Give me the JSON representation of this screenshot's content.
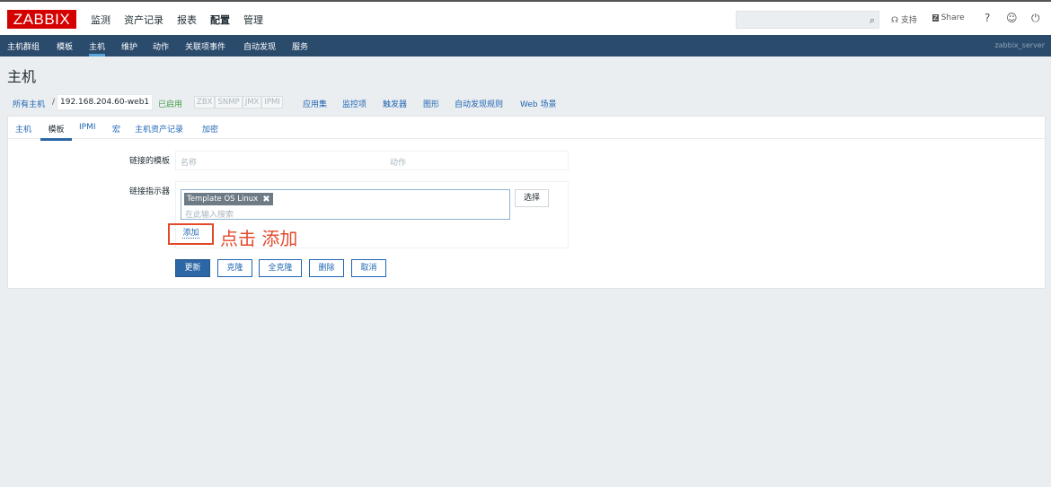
{
  "brand": "ZABBIX",
  "main_menu": [
    "监测",
    "资产记录",
    "报表",
    "配置",
    "管理"
  ],
  "main_menu_active": "配置",
  "header": {
    "support_label": "支持",
    "share_label": "Share",
    "help_label": "?"
  },
  "sub_menu": [
    "主机群组",
    "模板",
    "主机",
    "维护",
    "动作",
    "关联项事件",
    "自动发现",
    "服务"
  ],
  "sub_menu_active": "主机",
  "server_name": "zabbix_server",
  "page_title": "主机",
  "breadcrumb": {
    "all_hosts": "所有主机",
    "separator": "/",
    "host": "192.168.204.60-web1",
    "status": "已启用",
    "availability": [
      "ZBX",
      "SNMP",
      "JMX",
      "IPMI"
    ],
    "links": [
      "应用集",
      "监控项",
      "触发器",
      "图形",
      "自动发现规则",
      "Web 场景"
    ]
  },
  "tabs": [
    "主机",
    "模板",
    "IPMI",
    "宏",
    "主机资产记录",
    "加密"
  ],
  "active_tab": "模板",
  "form": {
    "linked_templates_label": "链接的模板",
    "col_name": "名称",
    "col_action": "动作",
    "link_indicator_label": "链接指示器",
    "selected_template": "Template OS Linux",
    "chip_remove": "✖",
    "search_placeholder": "在此输入搜索",
    "select_button": "选择",
    "add_link": "添加",
    "annotation": "点击 添加"
  },
  "buttons": {
    "update": "更新",
    "clone": "克隆",
    "full_clone": "全克隆",
    "delete": "删除",
    "cancel": "取消"
  },
  "colors": {
    "brand": "#d40000",
    "submenu_bg": "#2b4b6d",
    "primary": "#2b66a5",
    "annotation": "#e34a2c"
  }
}
